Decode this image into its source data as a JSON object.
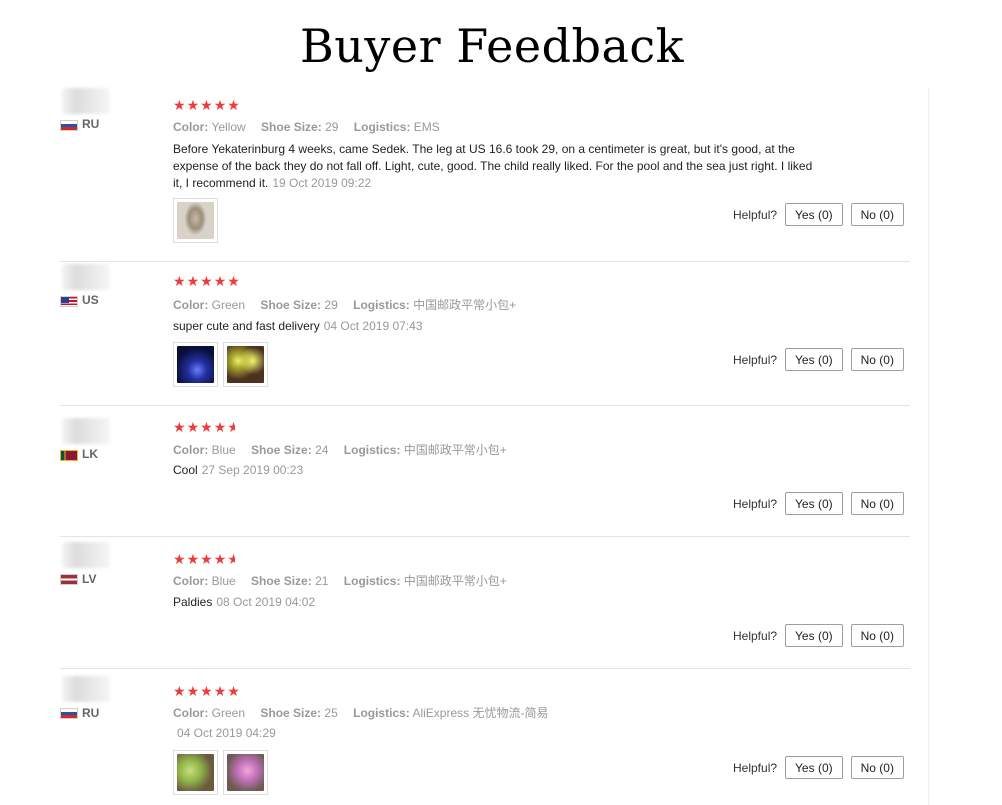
{
  "page": {
    "title": "Buyer Feedback"
  },
  "labels": {
    "color": "Color:",
    "shoe_size": "Shoe Size:",
    "logistics": "Logistics:",
    "helpful": "Helpful?"
  },
  "reviews": [
    {
      "country": "RU",
      "flag": "flag-ru-icon",
      "stars": 5,
      "color": "Yellow",
      "shoe_size": "29",
      "logistics": "EMS",
      "text": "Before Yekaterinburg 4 weeks, came Sedek. The leg at US 16.6 took 29, on a centimeter is great, but it's good, at the expense of the back they do not fall off. Light, cute, good. The child really liked. For the pool and the sea just right. I liked it, I recommend it.",
      "date": "19 Oct 2019 09:22",
      "photos": [
        "child-wearing-shoes-photo"
      ],
      "yes": "Yes (0)",
      "no": "No (0)"
    },
    {
      "country": "US",
      "flag": "flag-us-icon",
      "stars": 5,
      "color": "Green",
      "shoe_size": "29",
      "logistics": "中国邮政平常小包+",
      "text": "super cute and fast delivery",
      "date": "04 Oct 2019 07:43",
      "photos": [
        "light-up-shoe-dark-photo",
        "glowing-shoes-photo"
      ],
      "yes": "Yes (0)",
      "no": "No (0)"
    },
    {
      "country": "LK",
      "flag": "flag-lk-icon",
      "stars": 4.5,
      "color": "Blue",
      "shoe_size": "24",
      "logistics": "中国邮政平常小包+",
      "text": "Cool",
      "date": "27 Sep 2019 00:23",
      "photos": [],
      "yes": "Yes (0)",
      "no": "No (0)"
    },
    {
      "country": "LV",
      "flag": "flag-lv-icon",
      "stars": 4.5,
      "color": "Blue",
      "shoe_size": "21",
      "logistics": "中国邮政平常小包+",
      "text": "Paldies",
      "date": "08 Oct 2019 04:02",
      "photos": [],
      "yes": "Yes (0)",
      "no": "No (0)"
    },
    {
      "country": "RU",
      "flag": "flag-ru-icon",
      "stars": 5,
      "color": "Green",
      "shoe_size": "25",
      "logistics": "AliExpress 无忧物流-简易",
      "text": "",
      "date": "04 Oct 2019 04:29",
      "photos": [
        "green-shoes-photo",
        "pink-shoes-photo"
      ],
      "yes": "Yes (0)",
      "no": "No (0)"
    }
  ],
  "colors": {
    "star": "#ef3b3b",
    "muted": "#999999",
    "divider": "#e4e4e4"
  }
}
